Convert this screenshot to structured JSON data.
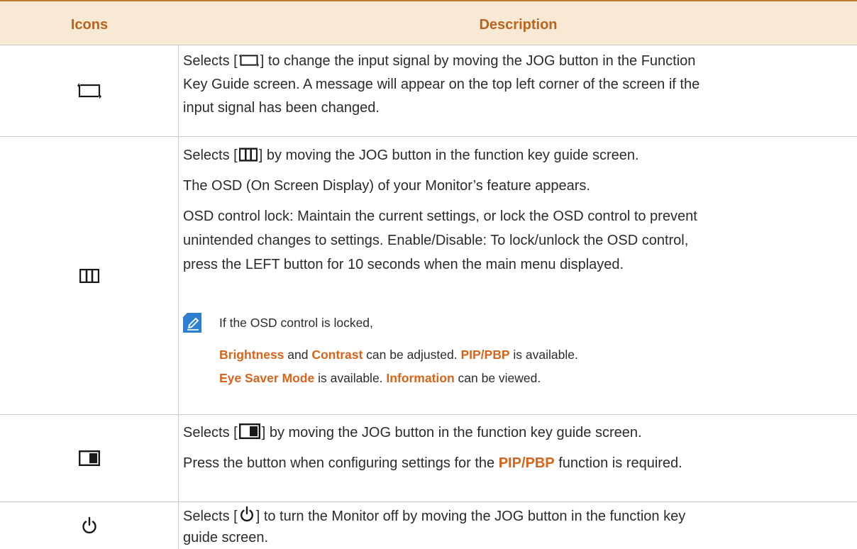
{
  "header": {
    "icons": "Icons",
    "description": "Description"
  },
  "rows": [
    {
      "icon": "input-source-icon",
      "lines": [
        {
          "pre": "Selects [",
          "post": "] to change the input signal by moving the JOG button in the Function"
        },
        {
          "text": "Key Guide screen. A message will appear on the top left corner of the screen if the"
        },
        {
          "text": "input signal has been changed."
        }
      ]
    },
    {
      "icon": "menu-icon",
      "p1": {
        "pre": "Selects [",
        "post": "] by moving the JOG button in the function key guide screen."
      },
      "p2": "The OSD (On Screen Display) of your Monitor’s feature appears.",
      "p3_line1": "OSD control lock: Maintain the current settings, or lock the OSD control to prevent",
      "p3_line2": "unintended changes to settings. Enable/Disable: To lock/unlock the OSD control,",
      "p3_line3": "press the LEFT button for 10 seconds when the main menu displayed.",
      "note": {
        "intro": "If the OSD control is locked,",
        "brightness": "Brightness",
        "and": " and ",
        "contrast": "Contrast",
        "can_adjust": " can be adjusted. ",
        "pip": "PIP/PBP",
        "is_available": " is available.",
        "eye_saver": "Eye Saver Mode",
        "is_available2": " is available. ",
        "information": "Information",
        "can_view": " can be viewed."
      }
    },
    {
      "icon": "pip-pbp-icon",
      "p1": {
        "pre": "Selects [",
        "post": "] by moving the JOG button in the function key guide screen."
      },
      "p2": {
        "pre": "Press the button when configuring settings for the ",
        "hl": "PIP/PBP",
        "post": " function is required."
      }
    },
    {
      "icon": "power-icon",
      "p1": {
        "pre": "Selects [",
        "post": "] to turn the Monitor off by moving the JOG button in the function key"
      },
      "p2": "guide screen."
    }
  ],
  "colors": {
    "accent": "#d6651b",
    "header_bg": "#f7e9d3",
    "header_text": "#b8641f",
    "note_icon": "#2f7fd1"
  }
}
